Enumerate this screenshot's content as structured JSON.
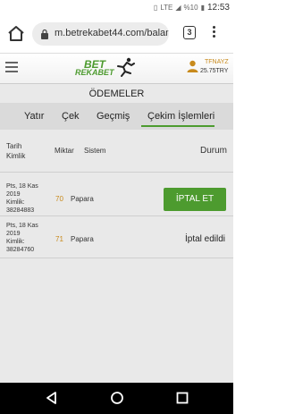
{
  "status_bar": {
    "network": "LTE",
    "battery": "%10",
    "time": "12:53"
  },
  "browser": {
    "url": "m.betrekabet44.com/balan",
    "tab_count": "3"
  },
  "site": {
    "logo_line1": "BET",
    "logo_line2": "REKABET",
    "user_name": "TFNAYZ",
    "balance": "25.75TRY"
  },
  "page": {
    "title": "ÖDEMELER",
    "tabs": [
      {
        "label": "Yatır"
      },
      {
        "label": "Çek"
      },
      {
        "label": "Geçmiş"
      },
      {
        "label": "Çekim İşlemleri",
        "active": true
      }
    ]
  },
  "table": {
    "headers": {
      "date_line1": "Tarih",
      "date_line2": "Kimlik",
      "amount": "Miktar",
      "system": "Sistem",
      "status": "Durum"
    },
    "rows": [
      {
        "date": "Pts, 18 Kas",
        "year": "2019",
        "id_label": "Kimlik:",
        "id": "38284883",
        "amount": "70",
        "system": "Papara",
        "action_label": "İPTAL ET"
      },
      {
        "date": "Pts, 18 Kas",
        "year": "2019",
        "id_label": "Kimlik:",
        "id": "38284760",
        "amount": "71",
        "system": "Papara",
        "status": "İptal edildi"
      }
    ]
  },
  "colors": {
    "accent": "#4d9b2f",
    "amount": "#c88a1c"
  }
}
